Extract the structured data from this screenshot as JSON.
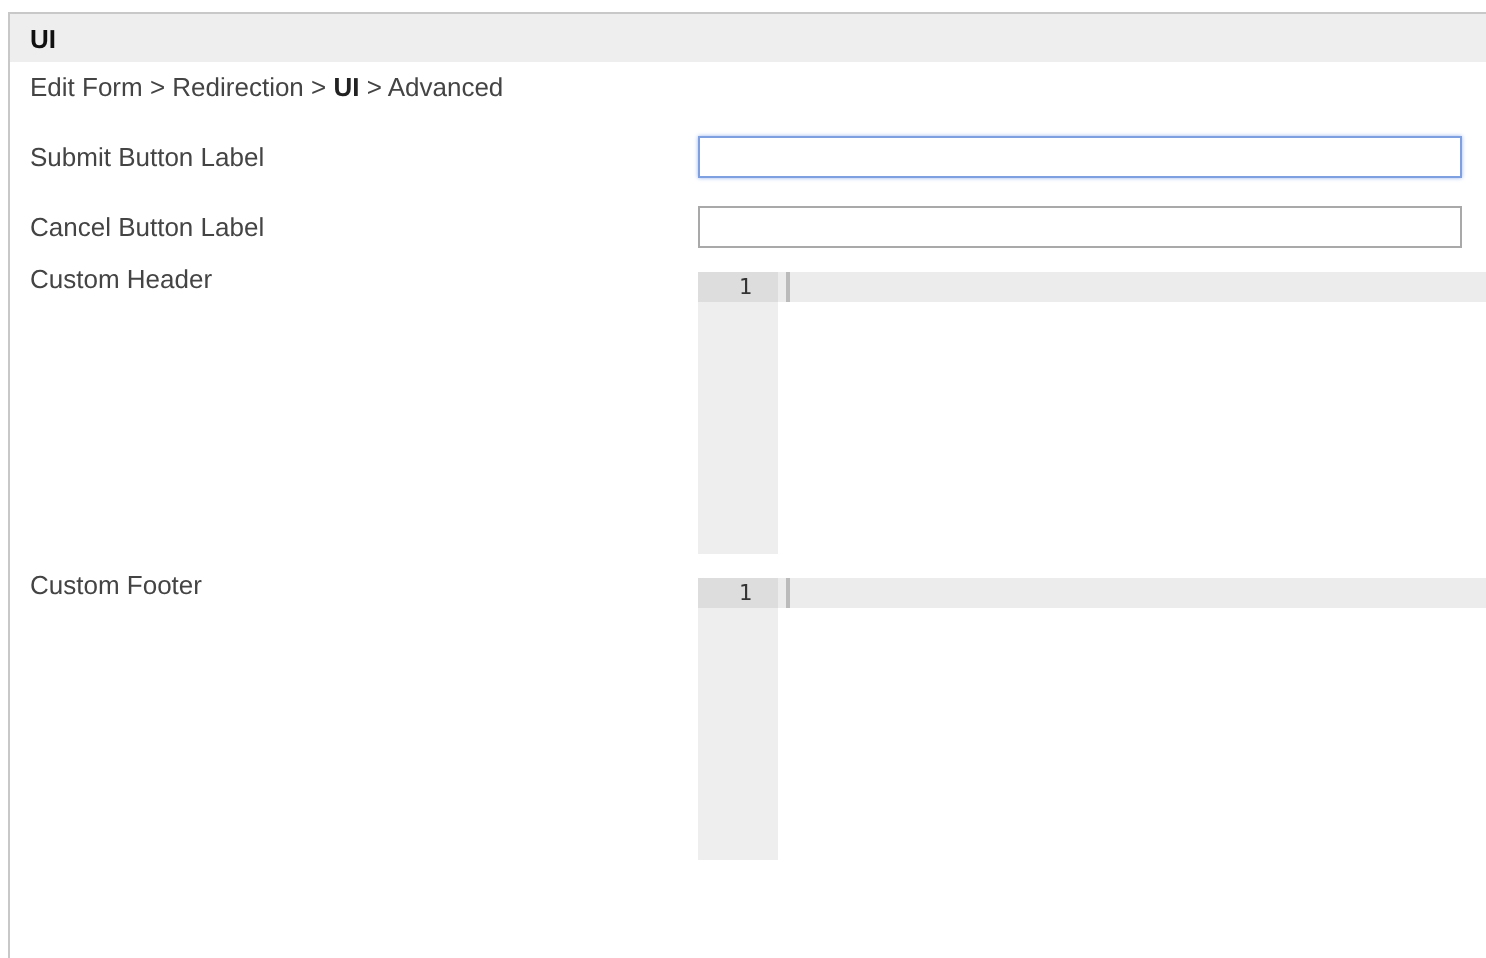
{
  "panel": {
    "title": "UI"
  },
  "breadcrumb": "Edit Form > Redirection > **UI** > Advanced",
  "fields": [
    {
      "kind": "text",
      "label": "Submit Button Label",
      "focused": true
    },
    {
      "kind": "text",
      "label": "Cancel Button Label",
      "focused": false
    },
    {
      "kind": "code",
      "label": "Custom Header",
      "line_numbers": [
        "1"
      ]
    },
    {
      "kind": "code",
      "label": "Custom Footer",
      "line_numbers": [
        "1"
      ]
    }
  ]
}
